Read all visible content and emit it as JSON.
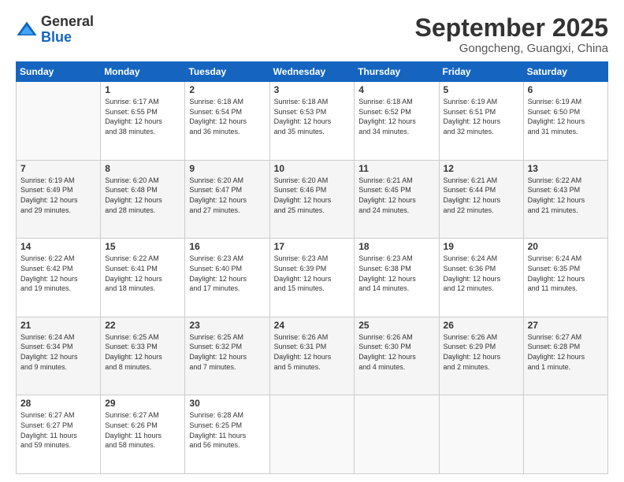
{
  "logo": {
    "general": "General",
    "blue": "Blue"
  },
  "header": {
    "month": "September 2025",
    "location": "Gongcheng, Guangxi, China"
  },
  "weekdays": [
    "Sunday",
    "Monday",
    "Tuesday",
    "Wednesday",
    "Thursday",
    "Friday",
    "Saturday"
  ],
  "weeks": [
    [
      {
        "day": "",
        "text": ""
      },
      {
        "day": "1",
        "text": "Sunrise: 6:17 AM\nSunset: 6:55 PM\nDaylight: 12 hours\nand 38 minutes."
      },
      {
        "day": "2",
        "text": "Sunrise: 6:18 AM\nSunset: 6:54 PM\nDaylight: 12 hours\nand 36 minutes."
      },
      {
        "day": "3",
        "text": "Sunrise: 6:18 AM\nSunset: 6:53 PM\nDaylight: 12 hours\nand 35 minutes."
      },
      {
        "day": "4",
        "text": "Sunrise: 6:18 AM\nSunset: 6:52 PM\nDaylight: 12 hours\nand 34 minutes."
      },
      {
        "day": "5",
        "text": "Sunrise: 6:19 AM\nSunset: 6:51 PM\nDaylight: 12 hours\nand 32 minutes."
      },
      {
        "day": "6",
        "text": "Sunrise: 6:19 AM\nSunset: 6:50 PM\nDaylight: 12 hours\nand 31 minutes."
      }
    ],
    [
      {
        "day": "7",
        "text": "Sunrise: 6:19 AM\nSunset: 6:49 PM\nDaylight: 12 hours\nand 29 minutes."
      },
      {
        "day": "8",
        "text": "Sunrise: 6:20 AM\nSunset: 6:48 PM\nDaylight: 12 hours\nand 28 minutes."
      },
      {
        "day": "9",
        "text": "Sunrise: 6:20 AM\nSunset: 6:47 PM\nDaylight: 12 hours\nand 27 minutes."
      },
      {
        "day": "10",
        "text": "Sunrise: 6:20 AM\nSunset: 6:46 PM\nDaylight: 12 hours\nand 25 minutes."
      },
      {
        "day": "11",
        "text": "Sunrise: 6:21 AM\nSunset: 6:45 PM\nDaylight: 12 hours\nand 24 minutes."
      },
      {
        "day": "12",
        "text": "Sunrise: 6:21 AM\nSunset: 6:44 PM\nDaylight: 12 hours\nand 22 minutes."
      },
      {
        "day": "13",
        "text": "Sunrise: 6:22 AM\nSunset: 6:43 PM\nDaylight: 12 hours\nand 21 minutes."
      }
    ],
    [
      {
        "day": "14",
        "text": "Sunrise: 6:22 AM\nSunset: 6:42 PM\nDaylight: 12 hours\nand 19 minutes."
      },
      {
        "day": "15",
        "text": "Sunrise: 6:22 AM\nSunset: 6:41 PM\nDaylight: 12 hours\nand 18 minutes."
      },
      {
        "day": "16",
        "text": "Sunrise: 6:23 AM\nSunset: 6:40 PM\nDaylight: 12 hours\nand 17 minutes."
      },
      {
        "day": "17",
        "text": "Sunrise: 6:23 AM\nSunset: 6:39 PM\nDaylight: 12 hours\nand 15 minutes."
      },
      {
        "day": "18",
        "text": "Sunrise: 6:23 AM\nSunset: 6:38 PM\nDaylight: 12 hours\nand 14 minutes."
      },
      {
        "day": "19",
        "text": "Sunrise: 6:24 AM\nSunset: 6:36 PM\nDaylight: 12 hours\nand 12 minutes."
      },
      {
        "day": "20",
        "text": "Sunrise: 6:24 AM\nSunset: 6:35 PM\nDaylight: 12 hours\nand 11 minutes."
      }
    ],
    [
      {
        "day": "21",
        "text": "Sunrise: 6:24 AM\nSunset: 6:34 PM\nDaylight: 12 hours\nand 9 minutes."
      },
      {
        "day": "22",
        "text": "Sunrise: 6:25 AM\nSunset: 6:33 PM\nDaylight: 12 hours\nand 8 minutes."
      },
      {
        "day": "23",
        "text": "Sunrise: 6:25 AM\nSunset: 6:32 PM\nDaylight: 12 hours\nand 7 minutes."
      },
      {
        "day": "24",
        "text": "Sunrise: 6:26 AM\nSunset: 6:31 PM\nDaylight: 12 hours\nand 5 minutes."
      },
      {
        "day": "25",
        "text": "Sunrise: 6:26 AM\nSunset: 6:30 PM\nDaylight: 12 hours\nand 4 minutes."
      },
      {
        "day": "26",
        "text": "Sunrise: 6:26 AM\nSunset: 6:29 PM\nDaylight: 12 hours\nand 2 minutes."
      },
      {
        "day": "27",
        "text": "Sunrise: 6:27 AM\nSunset: 6:28 PM\nDaylight: 12 hours\nand 1 minute."
      }
    ],
    [
      {
        "day": "28",
        "text": "Sunrise: 6:27 AM\nSunset: 6:27 PM\nDaylight: 11 hours\nand 59 minutes."
      },
      {
        "day": "29",
        "text": "Sunrise: 6:27 AM\nSunset: 6:26 PM\nDaylight: 11 hours\nand 58 minutes."
      },
      {
        "day": "30",
        "text": "Sunrise: 6:28 AM\nSunset: 6:25 PM\nDaylight: 11 hours\nand 56 minutes."
      },
      {
        "day": "",
        "text": ""
      },
      {
        "day": "",
        "text": ""
      },
      {
        "day": "",
        "text": ""
      },
      {
        "day": "",
        "text": ""
      }
    ]
  ]
}
